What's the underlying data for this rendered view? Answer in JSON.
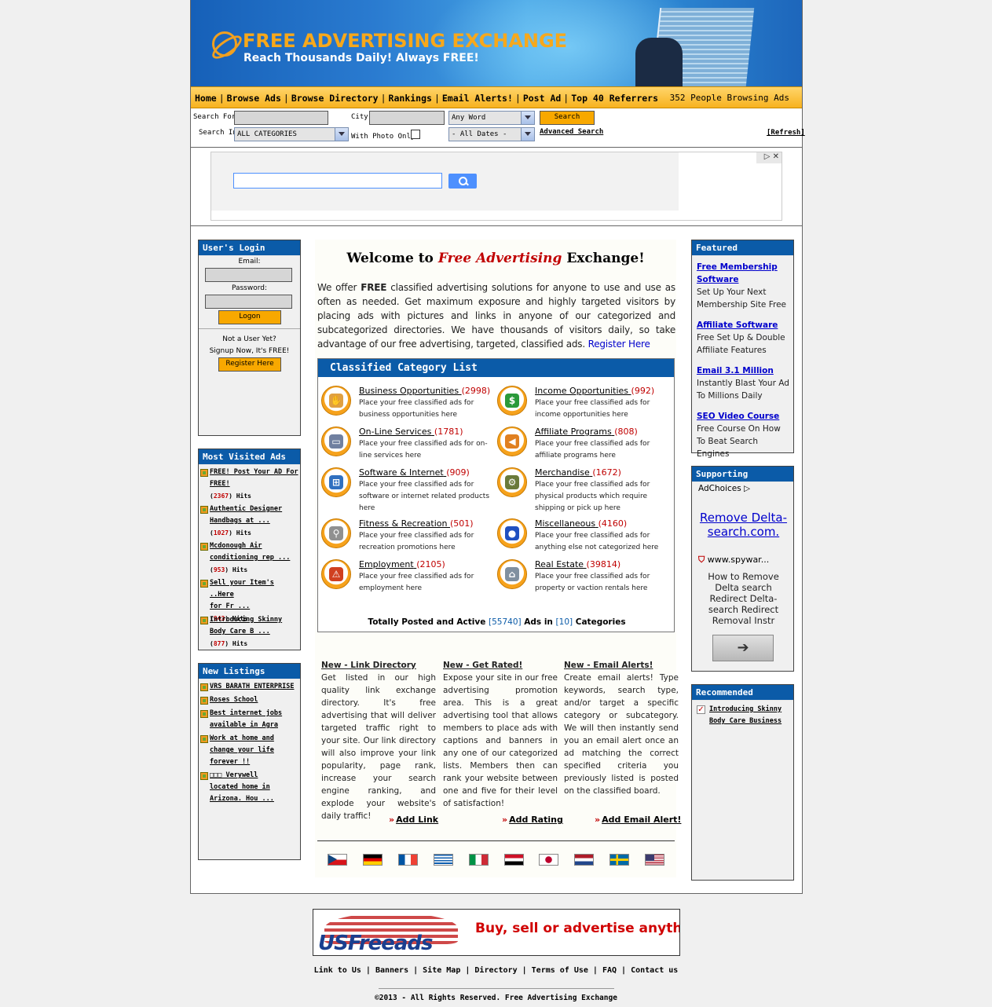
{
  "header": {
    "title": "FREE ADVERTISING EXCHANGE",
    "tagline": "Reach Thousands Daily! Always FREE!"
  },
  "nav": {
    "items": [
      "Home",
      "Browse Ads",
      "Browse Directory",
      "Rankings",
      "Email Alerts!",
      "Post Ad",
      "Top 40 Referrers"
    ],
    "browsing_count": "352 People Browsing Ads"
  },
  "search": {
    "search_for_label": "Search For:",
    "city_label": "City:",
    "word_select": "Any Word",
    "search_button": "Search",
    "search_in_label": "Search In:",
    "category_select": "ALL CATEGORIES",
    "photo_label": "With Photo Only:",
    "dates_select": "- All Dates -",
    "advanced_link": "Advanced Search",
    "refresh_link": "[Refresh]"
  },
  "login": {
    "title": "User's Login",
    "email_label": "Email:",
    "password_label": "Password:",
    "logon_button": "Logon",
    "not_user": "Not a User Yet?",
    "signup_text": "Signup Now, It's FREE!",
    "register_button": "Register Here"
  },
  "most_visited": {
    "title": "Most Visited Ads",
    "items": [
      {
        "l1": "FREE! Post Your AD For",
        "l2": "FREE!",
        "hits": "2367"
      },
      {
        "l1": "Authentic Designer",
        "l2": "Handbags at ...",
        "hits": "1027"
      },
      {
        "l1": "Mcdonough Air",
        "l2": "conditioning rep ...",
        "hits": "953"
      },
      {
        "l1": "Sell your Item's ..Here",
        "l2": "for Fr ...",
        "hits": "943"
      },
      {
        "l1": "Introducing Skinny",
        "l2": "Body Care B ...",
        "hits": "877"
      }
    ],
    "hits_label": "Hits"
  },
  "new_listings": {
    "title": "New Listings",
    "items": [
      [
        "VRS BARATH ENTERPRISE"
      ],
      [
        "Roses School"
      ],
      [
        "Best internet jobs",
        "available in Agra"
      ],
      [
        "Work at home and",
        "change your life",
        "forever !!"
      ],
      [
        "□□□ Verywell",
        "located home in",
        "Arizona. Hou ..."
      ]
    ]
  },
  "welcome": {
    "prefix": "Welcome to ",
    "highlight": "Free Advertising",
    "suffix": " Exchange!",
    "intro_a": "We offer ",
    "intro_bold": "FREE",
    "intro_b": " classified advertising solutions for anyone to use and use as often as needed. Get maximum exposure and highly targeted visitors by placing ads with pictures and links in anyone of our categorized and subcategorized directories. We have thousands of visitors daily, so take advantage of our free advertising, targeted, classified ads. ",
    "register_link": "Register Here"
  },
  "categories": {
    "title": "Classified Category List",
    "items": [
      {
        "name": "Business Opportunities",
        "count": "(2998)",
        "desc": "Place your free classified ads for business opportunities here",
        "icon": "handshake-icon",
        "color": "#e0a040"
      },
      {
        "name": "Income Opportunities",
        "count": "(992)",
        "desc": "Place your free classified ads for income opportunities here",
        "icon": "dollar-icon",
        "color": "#2a9a3a"
      },
      {
        "name": "On-Line Services",
        "count": "(1781)",
        "desc": "Place your free classified ads for on-line services here",
        "icon": "computer-icon",
        "color": "#7080a0"
      },
      {
        "name": "Affiliate Programs",
        "count": "(808)",
        "desc": "Place your free classified ads for affiliate programs here",
        "icon": "megaphone-icon",
        "color": "#e08020"
      },
      {
        "name": "Software & Internet",
        "count": "(909)",
        "desc": "Place your free classified ads for software or internet related products here",
        "icon": "windows-icon",
        "color": "#3070c0"
      },
      {
        "name": "Merchandise",
        "count": "(1672)",
        "desc": "Place your free classified ads for physical products which require shipping or pick up here",
        "icon": "gear-icon",
        "color": "#6a7a3a"
      },
      {
        "name": "Fitness & Recreation",
        "count": "(501)",
        "desc": "Place your free classified ads for recreation promotions here",
        "icon": "bicycle-icon",
        "color": "#909090"
      },
      {
        "name": "Miscellaneous",
        "count": "(4160)",
        "desc": "Place your free classified ads for anything else not categorized here",
        "icon": "color-balls-icon",
        "color": "#2050c0"
      },
      {
        "name": "Employment",
        "count": "(2105)",
        "desc": "Place your free classified ads for employment here",
        "icon": "worker-sign-icon",
        "color": "#d04020"
      },
      {
        "name": "Real Estate",
        "count": "(39814)",
        "desc": "Place your free classified ads for property or vaction rentals here",
        "icon": "house-icon",
        "color": "#8090a0"
      }
    ],
    "totals_a": "Totally Posted and Active ",
    "totals_ads": "[55740]",
    "totals_b": " Ads in ",
    "totals_cats": "[10]",
    "totals_c": " Categories"
  },
  "features": [
    {
      "title": "New - Link Directory",
      "text": "Get listed in our high quality link exchange directory. It's free advertising that will deliver targeted traffic right to your site. Our link directory will also improve your link popularity, page rank, increase your search engine ranking, and explode your website's daily traffic!",
      "action": "Add Link"
    },
    {
      "title": "New - Get Rated!",
      "text": "Expose your site in our free advertising promotion area. This is a great advertising tool that allows members to place ads with captions and banners in any one of our categorized lists. Members then can rank your website between one and five for their level of satisfaction!",
      "action": "Add Rating"
    },
    {
      "title": "New - Email Alerts!",
      "text": "Create email alerts! Type keywords, search type, and/or target a specific category or subcategory. We will then instantly send you an email alert once an ad matching the correct specified criteria you previously listed is posted on the classified board.",
      "action": "Add Email Alert!"
    }
  ],
  "flags": [
    "czech-flag",
    "german-flag",
    "french-flag",
    "greek-flag",
    "italian-flag",
    "egyptian-flag",
    "japanese-flag",
    "dutch-flag",
    "swedish-flag",
    "us-flag"
  ],
  "featured": {
    "title": "Featured",
    "items": [
      {
        "link": "Free Membership Software",
        "desc": "Set Up Your Next Membership Site Free"
      },
      {
        "link": "Affiliate Software",
        "desc": "Free Set Up & Double Affiliate Features"
      },
      {
        "link": "Email 3.1 Million",
        "desc": "Instantly Blast Your Ad To Millions Daily"
      },
      {
        "link": "SEO Video Course",
        "desc": "Free Course On How To Beat Search Engines"
      }
    ]
  },
  "supporting": {
    "title": "Supporting",
    "adchoices": "AdChoices",
    "ad_title": "Remove Delta-search.com.",
    "ad_domain": "www.spywar...",
    "ad_text": "How to Remove Delta search Redirect Delta-search Redirect Removal Instr"
  },
  "recommended": {
    "title": "Recommended",
    "items": [
      "Introducing Skinny Body Care Business"
    ]
  },
  "bottom_ad": {
    "brand": "USFreeads",
    "slogan": "Buy, sell or advertise anything"
  },
  "footer": {
    "links": [
      "Link to Us",
      "Banners",
      "Site Map",
      "Directory",
      "Terms of Use",
      "FAQ",
      "Contact us"
    ],
    "copyright": "©2013 - All Rights Reserved. Free Advertising Exchange"
  }
}
